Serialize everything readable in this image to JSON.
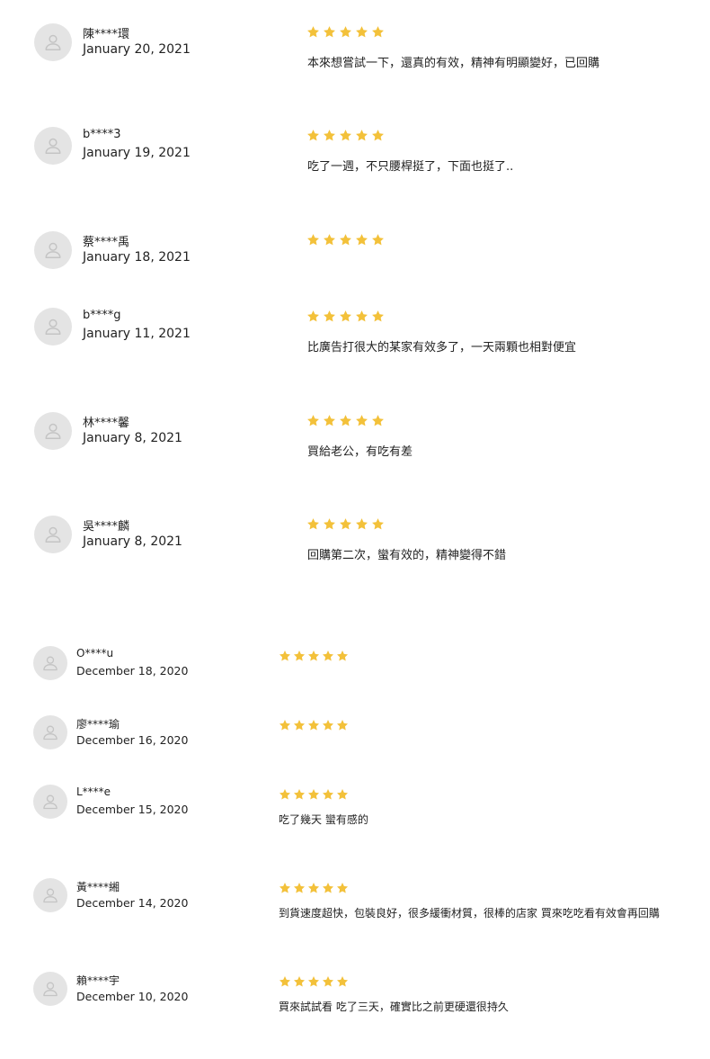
{
  "colors": {
    "star": "#f3c13a",
    "avatar_bg": "#e4e4e4",
    "avatar_icon": "#c4c4c4"
  },
  "icons": {
    "avatar": "user-icon",
    "rating": "star-icon"
  },
  "reviews": [
    {
      "name": "陳****環",
      "date": "January 20, 2021",
      "rating": 5,
      "comment": "本來想嘗試一下，還真的有效，精神有明顯變好，已回購"
    },
    {
      "name": "b****3",
      "date": "January 19, 2021",
      "rating": 5,
      "comment": "吃了一週，不只腰桿挺了，下面也挺了.."
    },
    {
      "name": "蔡****禹",
      "date": "January 18, 2021",
      "rating": 5,
      "comment": ""
    },
    {
      "name": "b****g",
      "date": "January 11, 2021",
      "rating": 5,
      "comment": "比廣告打很大的某家有效多了，一天兩顆也相對便宜"
    },
    {
      "name": "林****馨",
      "date": "January 8, 2021",
      "rating": 5,
      "comment": "買給老公，有吃有差"
    },
    {
      "name": "吳****麟",
      "date": "January 8, 2021",
      "rating": 5,
      "comment": "回購第二次，蠻有效的，精神變得不錯"
    },
    {
      "name": "O****u",
      "date": "December 18, 2020",
      "rating": 5,
      "comment": ""
    },
    {
      "name": "廖****瑜",
      "date": "December 16, 2020",
      "rating": 5,
      "comment": ""
    },
    {
      "name": "L****e",
      "date": "December 15, 2020",
      "rating": 5,
      "comment": "吃了幾天 蠻有感的"
    },
    {
      "name": "黃****緗",
      "date": "December 14, 2020",
      "rating": 5,
      "comment": "到貨速度超快，包裝良好，很多緩衝材質，很棒的店家 買來吃吃看有效會再回購"
    },
    {
      "name": "賴****宇",
      "date": "December 10, 2020",
      "rating": 5,
      "comment": "買來試試看 吃了三天，確實比之前更硬還很持久"
    }
  ]
}
